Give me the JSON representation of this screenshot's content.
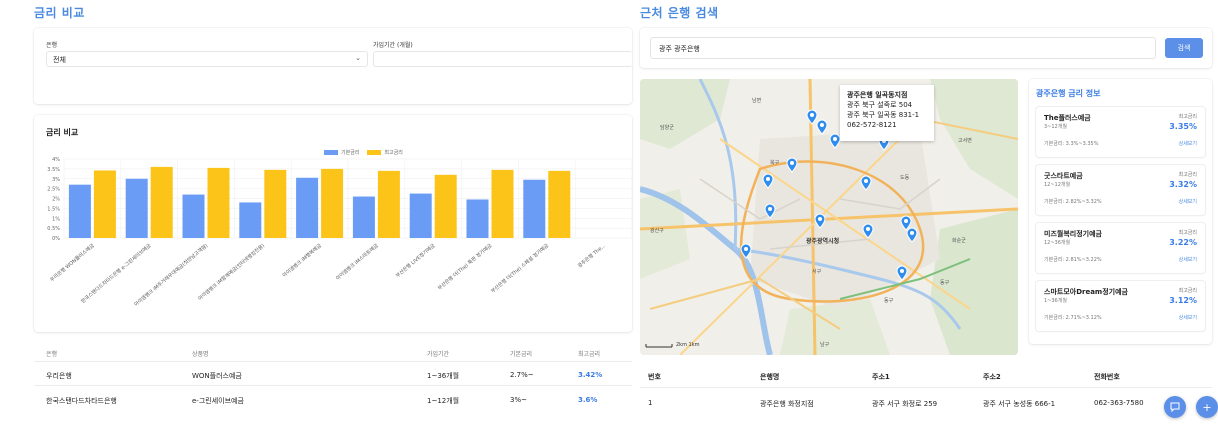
{
  "left": {
    "title": "금리 비교",
    "filter": {
      "bank_label": "은행",
      "bank_value": "전체",
      "period_label": "가입기간 (개월)",
      "period_value": ""
    },
    "chart_card_title": "금리 비교"
  },
  "chart_data": {
    "type": "bar",
    "title": "",
    "xlabel": "",
    "ylabel": "",
    "ylim": [
      0,
      4
    ],
    "y_ticks": [
      "4%",
      "3.5%",
      "3%",
      "2.5%",
      "2%",
      "1.5%",
      "1%",
      "0.5%",
      "0%"
    ],
    "categories": [
      "우리은행 WON플러스예금",
      "한국스탠다드차타드은행 e-그린세이브예금",
      "아이엠뱅크 iM주거래우대예금(첫만남고객형)",
      "아이엠뱅크 iM함께예금(인터넷뱅킹전용)",
      "아이엠뱅크 iM행복예금",
      "아이엠뱅크 iM스마트예금",
      "부산은행 LIVE정기예금",
      "부산은행 더(The) 특판 정기예금",
      "부산은행 더(The) 스페셜 정기예금",
      "광주은행 The..."
    ],
    "series": [
      {
        "name": "기본금리",
        "color": "#6a9cf5",
        "values": [
          2.7,
          3.0,
          2.2,
          1.8,
          3.05,
          2.1,
          2.25,
          1.95,
          2.95
        ]
      },
      {
        "name": "최고금리",
        "color": "#fcc419",
        "values": [
          3.42,
          3.6,
          3.55,
          3.45,
          3.5,
          3.4,
          3.2,
          3.45,
          3.4
        ]
      }
    ],
    "legend_position": "top-center",
    "grid": true
  },
  "table": {
    "headers": [
      "은행",
      "상품명",
      "가입기간",
      "기본금리",
      "최고금리"
    ],
    "rows": [
      [
        "우리은행",
        "WON플러스예금",
        "1~36개월",
        "2.7%~",
        "3.42%"
      ],
      [
        "한국스탠다드차타드은행",
        "e-그린세이브예금",
        "1~12개월",
        "3%~",
        "3.6%"
      ]
    ]
  },
  "right": {
    "title": "근처 은행 검색",
    "search_value": "광주 광주은행",
    "search_button": "검색",
    "map": {
      "popup_name": "광주은행 일곡동지점",
      "popup_addr1": "광주 북구 설죽로 504",
      "popup_addr2": "광주 북구 일곡동 831-1",
      "popup_phone": "062-572-8121",
      "city_label": "광주광역시청",
      "scale_label": "2km",
      "scale_label2": "1km",
      "labels": [
        "담양군",
        "남면",
        "북구",
        "광산구",
        "서구",
        "남구",
        "동구",
        "동구",
        "도동",
        "고서면",
        "화순군"
      ]
    },
    "info": {
      "title": "광주은행 금리 정보",
      "max_label": "최고금리",
      "detail_label": "상세보기",
      "products": [
        {
          "name": "The플러스예금",
          "period": "3~12개월",
          "base": "기본금리: 3.3%~3.35%",
          "max": "3.35%"
        },
        {
          "name": "굿스타트예금",
          "period": "12~12개월",
          "base": "기본금리: 2.82%~3.32%",
          "max": "3.32%"
        },
        {
          "name": "미즈월복리정기예금",
          "period": "12~36개월",
          "base": "기본금리: 2.81%~3.22%",
          "max": "3.22%"
        },
        {
          "name": "스마트모아Dream정기예금",
          "period": "1~36개월",
          "base": "기본금리: 2.71%~3.12%",
          "max": "3.12%"
        }
      ]
    },
    "branch_table": {
      "headers": [
        "번호",
        "은행명",
        "주소1",
        "주소2",
        "전화번호"
      ],
      "rows": [
        [
          "1",
          "광주은행 화정지점",
          "광주 서구 화정로 259",
          "광주 서구 농성동 666-1",
          "062-363-7580"
        ]
      ]
    },
    "fab_chat_icon": "chat-icon",
    "fab_plus_icon": "plus-icon"
  }
}
